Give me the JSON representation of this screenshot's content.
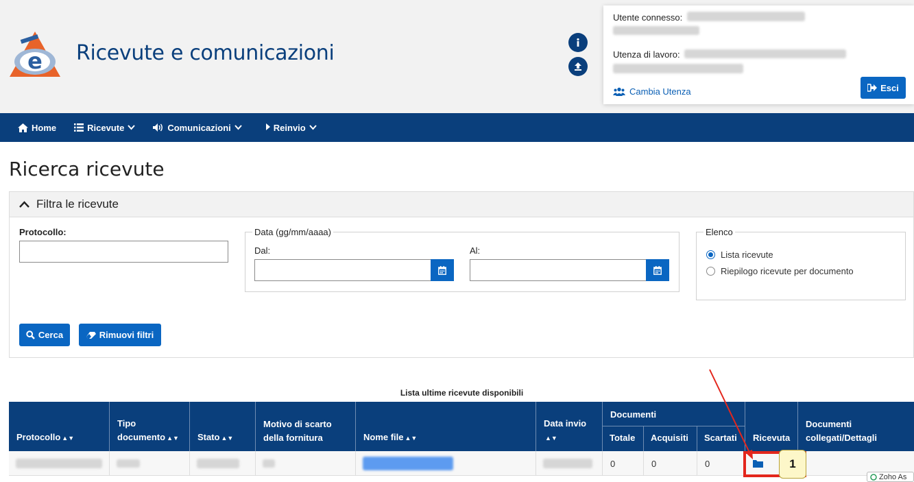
{
  "header": {
    "app_title": "Ricevute e comunicazioni",
    "user_label": "Utente connesso:",
    "work_label": "Utenza di lavoro:",
    "change_user": "Cambia Utenza",
    "logout": "Esci"
  },
  "nav": {
    "home": "Home",
    "ricevute": "Ricevute",
    "comunicazioni": "Comunicazioni",
    "reinvio": "Reinvio"
  },
  "page_title": "Ricerca ricevute",
  "filter": {
    "title": "Filtra le ricevute",
    "protocollo_label": "Protocollo:",
    "protocollo_value": "",
    "date_legend": "Data (gg/mm/aaaa)",
    "from_label": "Dal:",
    "from_value": "",
    "to_label": "Al:",
    "to_value": "",
    "list_legend": "Elenco",
    "options": [
      "Lista ricevute",
      "Riepilogo ricevute per documento"
    ],
    "selected_option": "Lista ricevute",
    "search_button": "Cerca",
    "clear_button": "Rimuovi filtri"
  },
  "table": {
    "caption": "Lista ultime ricevute disponibili",
    "headers": {
      "protocollo": "Protocollo",
      "tipo": "Tipo",
      "documento": "documento",
      "stato": "Stato",
      "motivo1": "Motivo di scarto",
      "motivo2": "della fornitura",
      "nome_file": "Nome file",
      "data_invio": "Data invio",
      "documenti": "Documenti",
      "totale": "Totale",
      "acquisiti": "Acquisiti",
      "scartati": "Scartati",
      "ricevuta": "Ricevuta",
      "collegati1": "Documenti",
      "collegati2": "collegati/Dettagli"
    },
    "rows": [
      {
        "totale": "0",
        "acquisiti": "0",
        "scartati": "0"
      }
    ]
  },
  "annotation": {
    "label": "1",
    "color": "#e3261c"
  },
  "overlay": {
    "zoho": "Zoho As"
  },
  "colors": {
    "brand_dark": "#0a3f7c",
    "brand_button": "#0a66c2",
    "logo_orange": "#e8632a"
  }
}
